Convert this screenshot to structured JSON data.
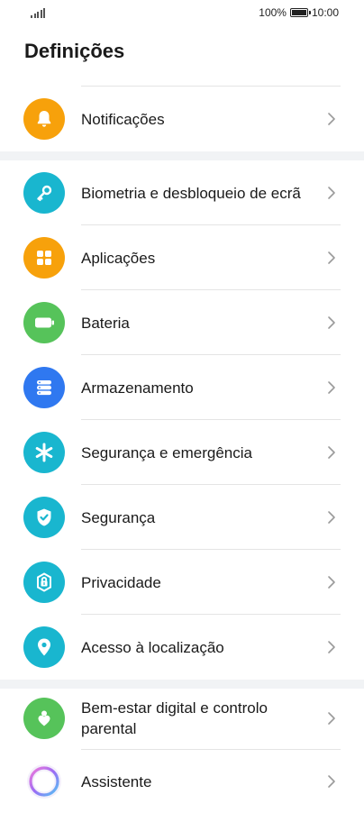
{
  "status": {
    "battery_percent": "100%",
    "time": "10:00"
  },
  "header": {
    "title": "Definições"
  },
  "groups": [
    {
      "items": [
        {
          "label": "Notificações",
          "icon": "bell-icon",
          "color": "#f7a10b"
        }
      ]
    },
    {
      "items": [
        {
          "label": "Biometria e desbloqueio de ecrã",
          "icon": "key-icon",
          "color": "#19b6cf"
        },
        {
          "label": "Aplicações",
          "icon": "apps-grid-icon",
          "color": "#f7a10b"
        },
        {
          "label": "Bateria",
          "icon": "battery-icon",
          "color": "#56c35a"
        },
        {
          "label": "Armazenamento",
          "icon": "storage-icon",
          "color": "#2f78f0"
        },
        {
          "label": "Segurança e emergência",
          "icon": "asterisk-icon",
          "color": "#19b6cf"
        },
        {
          "label": "Segurança",
          "icon": "shield-check-icon",
          "color": "#19b6cf"
        },
        {
          "label": "Privacidade",
          "icon": "privacy-lock-icon",
          "color": "#19b6cf"
        },
        {
          "label": "Acesso à localização",
          "icon": "location-pin-icon",
          "color": "#19b6cf"
        }
      ]
    },
    {
      "items": [
        {
          "label": "Bem-estar digital e controlo parental",
          "icon": "wellbeing-icon",
          "color": "#56c35a"
        },
        {
          "label": "Assistente",
          "icon": "assistant-icon",
          "color": "#ffffff"
        }
      ]
    }
  ]
}
